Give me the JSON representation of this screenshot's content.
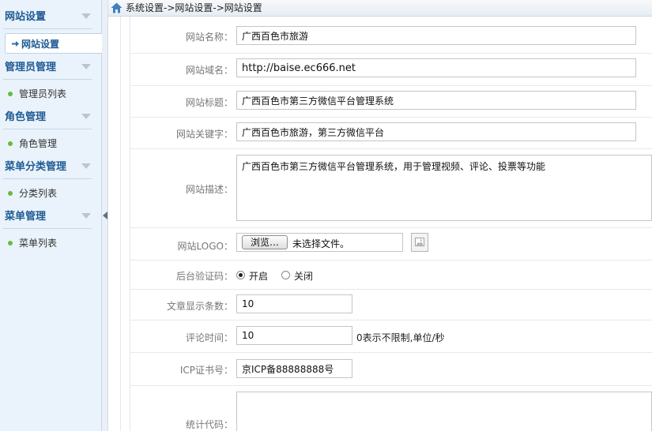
{
  "sidebar": {
    "groups": [
      {
        "title": "网站设置",
        "items": [
          {
            "label": "网站设置"
          }
        ]
      },
      {
        "title": "管理员管理",
        "items": [
          {
            "label": "管理员列表"
          }
        ]
      },
      {
        "title": "角色管理",
        "items": [
          {
            "label": "角色管理"
          }
        ]
      },
      {
        "title": "菜单分类管理",
        "items": [
          {
            "label": "分类列表"
          }
        ]
      },
      {
        "title": "菜单管理",
        "items": [
          {
            "label": "菜单列表"
          }
        ]
      }
    ]
  },
  "breadcrumb": "系统设置->网站设置->网站设置",
  "form": {
    "site_name": {
      "label": "网站名称：",
      "value": "广西百色市旅游"
    },
    "site_domain": {
      "label": "网站域名：",
      "value": "http://baise.ec666.net"
    },
    "site_title": {
      "label": "网站标题：",
      "value": "广西百色市第三方微信平台管理系统"
    },
    "site_keywords": {
      "label": "网站关键字：",
      "value": "广西百色市旅游，第三方微信平台"
    },
    "site_description": {
      "label": "网站描述：",
      "value": "广西百色市第三方微信平台管理系统，用于管理视频、评论、投票等功能"
    },
    "site_logo": {
      "label": "网站LOGO：",
      "button": "浏览…",
      "status": "未选择文件。"
    },
    "captcha": {
      "label": "后台验证码：",
      "options": [
        "开启",
        "关闭"
      ],
      "selected": "开启"
    },
    "article_count": {
      "label": "文章显示条数：",
      "value": "10"
    },
    "comment_time": {
      "label": "评论时间：",
      "value": "10",
      "note": "0表示不限制,单位/秒"
    },
    "icp": {
      "label": "ICP证书号：",
      "value": "京ICP备88888888号"
    },
    "stats_code": {
      "label": "统计代码：",
      "value": ""
    }
  },
  "colors": {
    "sidebar_bg": "#eaf3fb",
    "group_title": "#1e5a94",
    "bullet": "#6bb93f"
  }
}
